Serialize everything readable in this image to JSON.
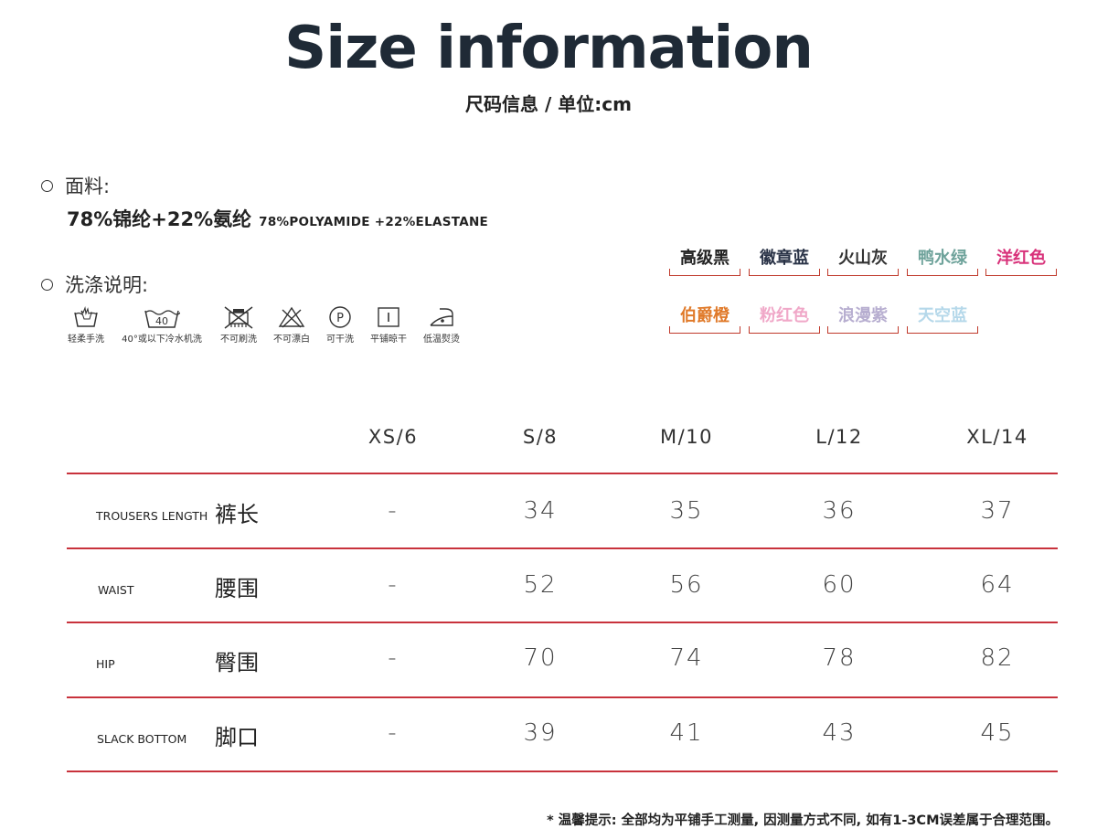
{
  "header": {
    "title": "Size information",
    "subtitle": "尺码信息 / 单位:cm"
  },
  "fabric": {
    "heading": "面料:",
    "composition_cn": "78%锦纶+22%氨纶",
    "composition_en": "78%POLYAMIDE +22%ELASTANE"
  },
  "care": {
    "heading": "洗涤说明:",
    "items": [
      {
        "icon": "hand-wash-icon",
        "label": "轻柔手洗"
      },
      {
        "icon": "machine-wash-40-icon",
        "label": "40°或以下冷水机洗",
        "value": "40"
      },
      {
        "icon": "no-brush-icon",
        "label": "不可刷洗"
      },
      {
        "icon": "no-bleach-icon",
        "label": "不可漂白"
      },
      {
        "icon": "dry-clean-p-icon",
        "label": "可干洗",
        "value": "P"
      },
      {
        "icon": "flat-dry-icon",
        "label": "平铺晾干"
      },
      {
        "icon": "low-iron-icon",
        "label": "低温熨烫"
      }
    ]
  },
  "colors": [
    {
      "name": "高级黑",
      "color": "#222222"
    },
    {
      "name": "徽章蓝",
      "color": "#2a3347"
    },
    {
      "name": "火山灰",
      "color": "#333333"
    },
    {
      "name": "鸭水绿",
      "color": "#6fa39b"
    },
    {
      "name": "洋红色",
      "color": "#d8327a"
    },
    {
      "name": "伯爵橙",
      "color": "#e07a2a"
    },
    {
      "name": "粉红色",
      "color": "#f0a8c8"
    },
    {
      "name": "浪漫紫",
      "color": "#b7aed0"
    },
    {
      "name": "天空蓝",
      "color": "#b5d8ea"
    }
  ],
  "table": {
    "sizes": [
      "XS/6",
      "S/8",
      "M/10",
      "L/12",
      "XL/14"
    ],
    "rows": [
      {
        "en": "TROUSERS LENGTH",
        "cn": "裤长",
        "values": [
          "-",
          "34",
          "35",
          "36",
          "37"
        ]
      },
      {
        "en": "WAIST",
        "cn": "腰围",
        "values": [
          "-",
          "52",
          "56",
          "60",
          "64"
        ]
      },
      {
        "en": "HIP",
        "cn": "臀围",
        "values": [
          "-",
          "70",
          "74",
          "78",
          "82"
        ]
      },
      {
        "en": "SLACK BOTTOM",
        "cn": "脚口",
        "values": [
          "-",
          "39",
          "41",
          "43",
          "45"
        ]
      }
    ]
  },
  "footnote": "* 温馨提示: 全部均为平铺手工测量, 因测量方式不同, 如有1-3CM误差属于合理范围。",
  "accent": "#c8323c"
}
